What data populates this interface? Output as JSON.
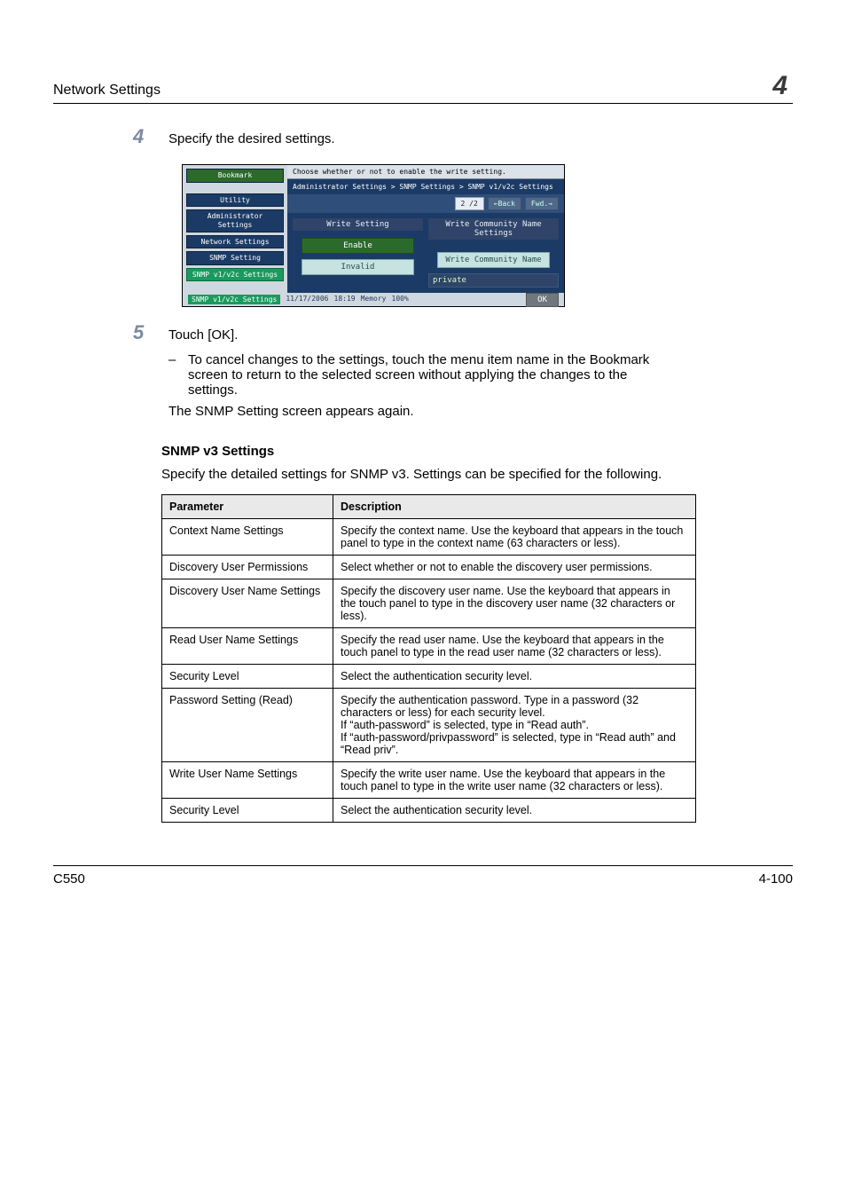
{
  "runhead": {
    "title": "Network Settings",
    "chapter": "4"
  },
  "step4": {
    "num": "4",
    "text": "Specify the desired settings."
  },
  "screenshot": {
    "topbar": "Choose whether or not to enable the write setting.",
    "breadcrumb": "Administrator Settings > SNMP Settings > SNMP v1/v2c Settings",
    "pager": {
      "page": "2 /2",
      "back": "Back",
      "fwd": "Fwd."
    },
    "nav": {
      "bookmark": "Bookmark",
      "utility": "Utility",
      "admin": "Administrator Settings",
      "network": "Network Settings",
      "snmp": "SNMP Setting",
      "current": "SNMP v1/v2c Settings"
    },
    "col1": {
      "title": "Write Setting",
      "enable": "Enable",
      "invalid": "Invalid"
    },
    "col2": {
      "title": "Write Community Name Settings",
      "btn": "Write Community Name",
      "value": "private"
    },
    "footer": {
      "date": "11/17/2006",
      "time": "18:19",
      "mem_label": "Memory",
      "mem_val": "100%",
      "ok": "OK"
    }
  },
  "step5": {
    "num": "5",
    "text": "Touch [OK].",
    "sub_dash": "–",
    "sub_text": "To cancel changes to the settings, touch the menu item name in the Bookmark screen to return to the selected screen without applying the changes to the settings.",
    "after": "The SNMP Setting screen appears again."
  },
  "section": {
    "heading": "SNMP v3 Settings",
    "intro": "Specify the detailed settings for SNMP v3. Settings can be specified for the following."
  },
  "table": {
    "head_param": "Parameter",
    "head_desc": "Description",
    "rows": [
      {
        "p": "Context Name Settings",
        "d": "Specify the context name. Use the keyboard that appears in the touch panel to type in the context name (63 characters or less)."
      },
      {
        "p": "Discovery User Permissions",
        "d": "Select whether or not to enable the discovery user permissions."
      },
      {
        "p": "Discovery User Name Settings",
        "d": "Specify the discovery user name. Use the keyboard that appears in the touch panel to type in the discovery user name (32 characters or less)."
      },
      {
        "p": "Read User Name Settings",
        "d": "Specify the read user name. Use the keyboard that appears in the touch panel to type in the read user name (32 characters or less)."
      },
      {
        "p": "Security Level",
        "d": "Select the authentication security level."
      },
      {
        "p": "Password Setting (Read)",
        "d": "Specify the authentication password. Type in a password (32 characters or less) for each security level.\nIf “auth-password” is selected, type in “Read auth”.\nIf “auth-password/privpassword” is selected, type in “Read auth” and “Read priv”."
      },
      {
        "p": "Write User Name Settings",
        "d": "Specify the write user name. Use the keyboard that appears in the touch panel to type in the write user name (32 characters or less)."
      },
      {
        "p": "Security Level",
        "d": "Select the authentication security level."
      }
    ]
  },
  "footer": {
    "left": "C550",
    "right": "4-100"
  }
}
